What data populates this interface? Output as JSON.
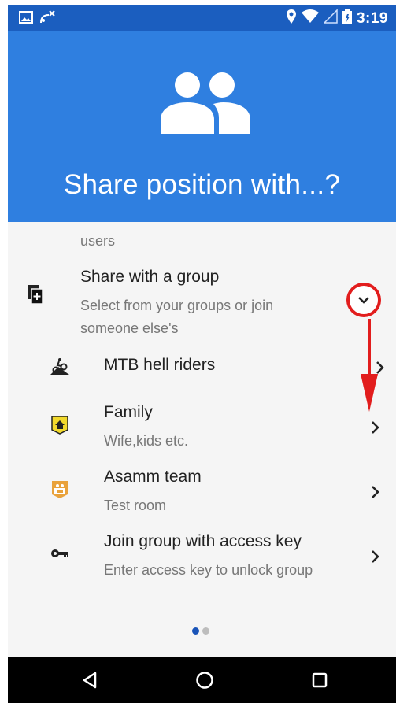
{
  "status_bar": {
    "time": "3:19",
    "left_icons": [
      "image-icon",
      "satellite-off-icon"
    ],
    "right_icons": [
      "location-icon",
      "wifi-icon",
      "signal-icon",
      "battery-icon"
    ]
  },
  "header": {
    "title": "Share position with...?",
    "icon": "group-icon"
  },
  "content": {
    "previous_item_tail": "users",
    "share_group": {
      "title": "Share with a group",
      "subtitle": "Select from your groups or join someone else's",
      "icon": "add-document-icon",
      "expand_icon": "chevron-down-icon"
    },
    "groups": [
      {
        "title": "MTB hell riders",
        "subtitle": "",
        "icon": "mountain-bike-icon"
      },
      {
        "title": "Family",
        "subtitle": "Wife,kids etc.",
        "icon": "home-badge-icon"
      },
      {
        "title": "Asamm team",
        "subtitle": "Test room",
        "icon": "team-badge-icon"
      },
      {
        "title": "Join group with access key",
        "subtitle": "Enter access key to unlock group",
        "icon": "key-icon"
      }
    ],
    "page_indicator": {
      "pages": 2,
      "current": 1
    }
  },
  "colors": {
    "status_bar": "#1b5ebf",
    "header": "#2f7fe0",
    "background": "#f5f5f5",
    "annotation": "#e21d1d",
    "dot_active": "#1a54b8",
    "dot_inactive": "#bdbdbd",
    "family_badge": "#f2d92c",
    "team_badge": "#e9a23b"
  },
  "nav": [
    "back-icon",
    "home-icon",
    "recents-icon"
  ]
}
